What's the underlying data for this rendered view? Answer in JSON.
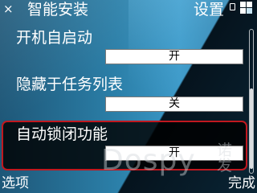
{
  "header": {
    "close_symbol": "×",
    "title": "智能安装",
    "right_title": "设置",
    "status_icons": [
      "phone-icon",
      "apps-grid-icon"
    ]
  },
  "settings": [
    {
      "label": "开机自启动",
      "value": "开",
      "selected": false
    },
    {
      "label": "隐藏于任务列表",
      "value": "关",
      "selected": false
    },
    {
      "label": "自动锁闭功能",
      "value": "开",
      "selected": true
    }
  ],
  "scrollbar": {
    "position": 0.6
  },
  "watermark": {
    "text": "Dospy",
    "mark": "诺 发"
  },
  "softkeys": {
    "left": "选项",
    "right": "完成"
  },
  "colors": {
    "selection_border": "#c0181f",
    "background": "#2b7fa8"
  }
}
